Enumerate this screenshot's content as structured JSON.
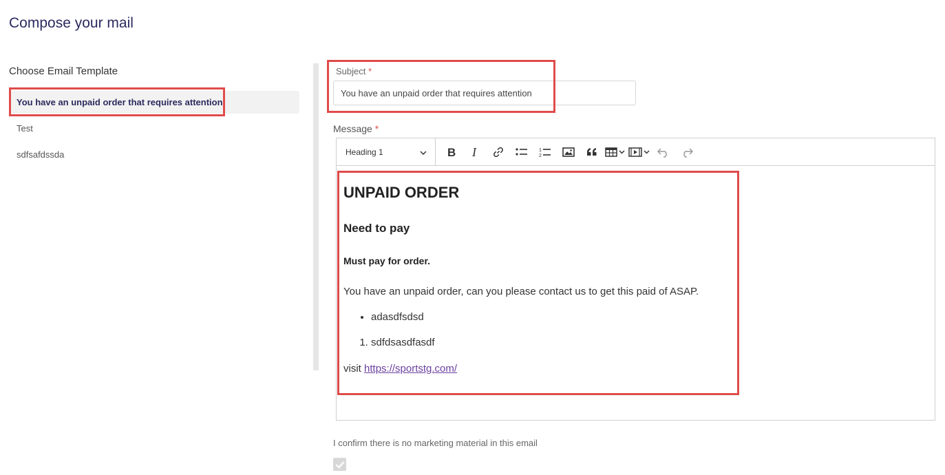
{
  "page": {
    "title": "Compose your mail"
  },
  "templates": {
    "heading": "Choose Email Template",
    "items": [
      {
        "label": "You have an unpaid order that requires attention"
      },
      {
        "label": "Test"
      },
      {
        "label": "sdfsafdssda"
      }
    ]
  },
  "subject": {
    "label": "Subject",
    "required_mark": "*",
    "value": "You have an unpaid order that requires attention"
  },
  "message": {
    "label": "Message",
    "required_mark": "*",
    "toolbar": {
      "heading_select": "Heading 1",
      "icons": [
        "bold-icon",
        "italic-icon",
        "link-icon",
        "bulleted-list-icon",
        "numbered-list-icon",
        "image-icon",
        "blockquote-icon",
        "table-icon",
        "media-icon",
        "undo-icon",
        "redo-icon"
      ]
    },
    "content": {
      "h1": "UNPAID ORDER",
      "h2": "Need to pay",
      "h3": "Must pay for order.",
      "paragraph": "You have an unpaid order, can you please contact us to get this paid of ASAP.",
      "bullet_items": [
        "adasdfsdsd"
      ],
      "numbered_items": [
        "sdfdsasdfasdf"
      ],
      "visit_prefix": "visit",
      "link_text": "https://sportstg.com/"
    }
  },
  "confirm": {
    "label": "I confirm there is no marketing material in this email",
    "checked": true
  },
  "colors": {
    "title": "#2b2a5e",
    "highlight": "#e04b4b",
    "required": "#d9534f",
    "link": "#6b3fa0"
  }
}
